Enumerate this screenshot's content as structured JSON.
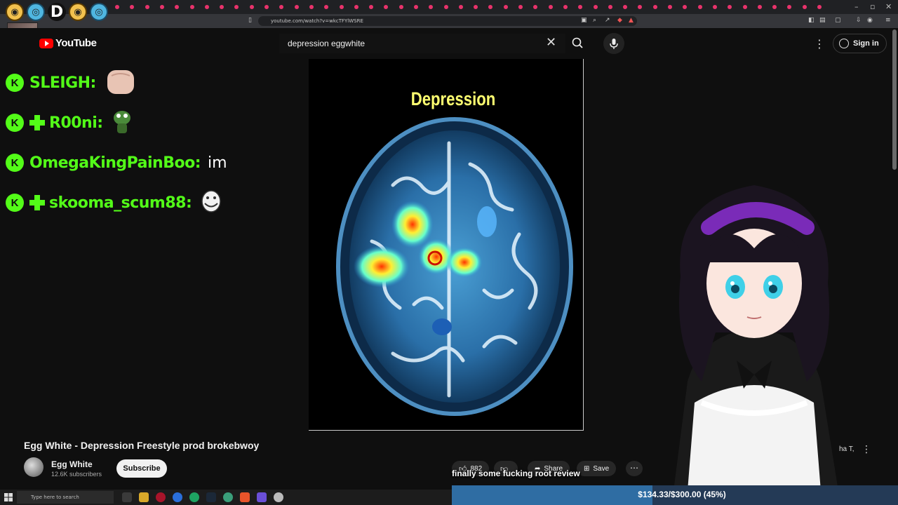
{
  "browser": {
    "address_url": "youtube.com/watch?v=wkcTFYlWSRE"
  },
  "overlay": {
    "emote_letter": "D"
  },
  "header": {
    "logo_text": "YouTube",
    "search_value": "depression eggwhite",
    "sign_in_label": "Sign in"
  },
  "chat": {
    "badge_letter": "K",
    "messages": [
      {
        "user": "SLEIGH:",
        "text": "",
        "subscriber": false,
        "emote": "fist-emote"
      },
      {
        "user": "R00ni:",
        "text": "",
        "subscriber": true,
        "emote": "frog-emote"
      },
      {
        "user": "OmegaKingPainBoo:",
        "text": "im",
        "subscriber": false,
        "emote": ""
      },
      {
        "user": "skooma_scum88:",
        "text": "",
        "subscriber": true,
        "emote": "trollface-emote"
      }
    ]
  },
  "video": {
    "overlay_title": "Depression"
  },
  "info": {
    "title": "Egg White - Depression Freestyle prod brokebwoy",
    "channel_name": "Egg White",
    "subscribers": "12.6K subscribers",
    "subscribe_label": "Subscribe",
    "likes": "882",
    "share_label": "Share",
    "save_label": "Save",
    "truncated_text": "ha T,"
  },
  "stream": {
    "caption": "finally some fucking root review",
    "goal_text": "$134.33/$300.00 (45%)",
    "goal_fraction": 0.45
  },
  "taskbar": {
    "search_placeholder": "Type here to search"
  },
  "colors": {
    "kick_green": "#53fc18",
    "youtube_red": "#ff0000",
    "title_yellow": "#ffff70",
    "goal_fill": "#2f6da3"
  }
}
